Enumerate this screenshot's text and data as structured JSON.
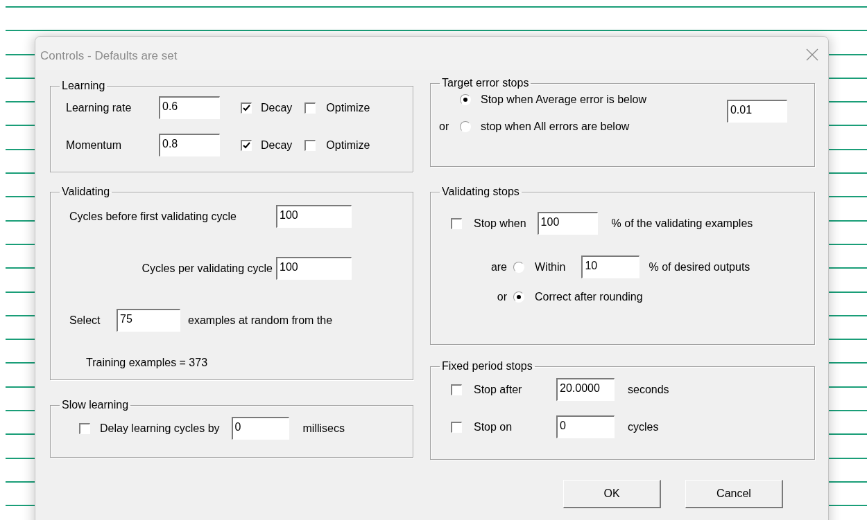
{
  "window": {
    "title": "Controls - Defaults are set"
  },
  "learning": {
    "title": "Learning",
    "rows": [
      {
        "label": "Learning rate",
        "value": "0.6",
        "decay": {
          "label": "Decay",
          "checked": true
        },
        "optimize": {
          "label": "Optimize",
          "checked": false
        }
      },
      {
        "label": "Momentum",
        "value": "0.8",
        "decay": {
          "label": "Decay",
          "checked": true
        },
        "optimize": {
          "label": "Optimize",
          "checked": false
        }
      }
    ]
  },
  "validating": {
    "title": "Validating",
    "first_cycle": {
      "label": "Cycles before first validating cycle",
      "value": "100"
    },
    "per_cycle": {
      "label": "Cycles per validating cycle",
      "value": "100"
    },
    "select": {
      "label": "Select",
      "value": "75",
      "suffix": "examples at random from the"
    },
    "training_examples": "Training examples = 373"
  },
  "slow_learning": {
    "title": "Slow learning",
    "delay": {
      "label": "Delay learning cycles by",
      "checked": false,
      "value": "0",
      "unit": "millisecs"
    }
  },
  "target_error_stops": {
    "title": "Target error stops",
    "options": [
      {
        "label": "Stop when Average error is below",
        "selected": true
      },
      {
        "prefix": "or",
        "label": "stop when All errors are below",
        "selected": false
      }
    ],
    "value": "0.01"
  },
  "validating_stops": {
    "title": "Validating stops",
    "stop_when": {
      "label": "Stop when",
      "checked": false,
      "value": "100",
      "suffix": "% of the validating examples"
    },
    "options": [
      {
        "prefix": "are",
        "label": "Within",
        "selected": false,
        "value": "10",
        "suffix": "% of desired outputs"
      },
      {
        "prefix": "or",
        "label": "Correct after rounding",
        "selected": true
      }
    ]
  },
  "fixed_period_stops": {
    "title": "Fixed period stops",
    "rows": [
      {
        "label": "Stop after",
        "checked": false,
        "value": "20.0000",
        "unit": "seconds"
      },
      {
        "label": "Stop on",
        "checked": false,
        "value": "0",
        "unit": "cycles"
      }
    ]
  },
  "buttons": [
    "OK",
    "Cancel"
  ]
}
